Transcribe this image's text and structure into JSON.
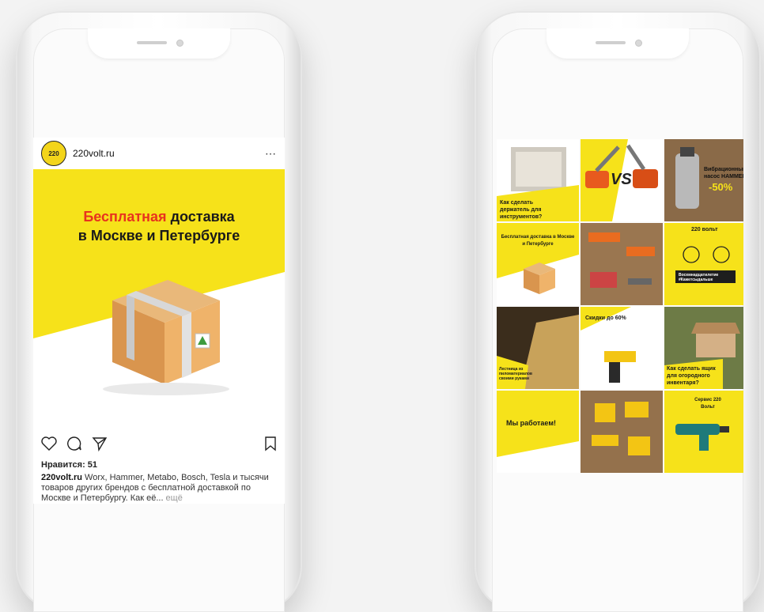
{
  "left_phone": {
    "post": {
      "username": "220volt.ru",
      "avatar_text": "220",
      "more_icon": "⋯",
      "headline_red": "Бесплатная",
      "headline_rest_line1": " доставка",
      "headline_line2": "в Москве и Петербурге",
      "likes": "Нравится: 51",
      "caption_user": "220volt.ru",
      "caption_text": " Worx, Hammer, Metabo, Bosch, Tesla и тысячи товаров других брендов с бесплатной доставкой по Москве и Петербургу. Как её...",
      "caption_more": " ещё",
      "icons": [
        "heart-icon",
        "comment-icon",
        "share-icon",
        "bookmark-icon"
      ]
    }
  },
  "right_phone": {
    "tiles": [
      {
        "text": "Как сделать держатель для инструментов?",
        "style": "w"
      },
      {
        "text": "VS",
        "style": "y"
      },
      {
        "text": "Вибрационный насос HAMMER",
        "badge": "-50%",
        "style": "wood"
      },
      {
        "text": "Бесплатная доставка в Москве и Петербурге",
        "style": "y"
      },
      {
        "text": "",
        "style": "wood"
      },
      {
        "text": "220 вольт",
        "text2": "Восемнадцатилетие #Кажетсыдальше",
        "style": "y"
      },
      {
        "text": "Лестница из пиломатериалов своими руками",
        "style": "dark"
      },
      {
        "text": "Скидки до 60%",
        "style": "w"
      },
      {
        "text": "Как сделать ящик для огородного инвентаря?",
        "style": "green"
      },
      {
        "text": "Мы работаем!",
        "style": "y"
      },
      {
        "text": "",
        "style": "wood"
      },
      {
        "text": "Сервис 220 Вольт",
        "style": "y"
      }
    ]
  },
  "colors": {
    "brand_yellow": "#f6e21a",
    "accent_red": "#e8321e"
  }
}
